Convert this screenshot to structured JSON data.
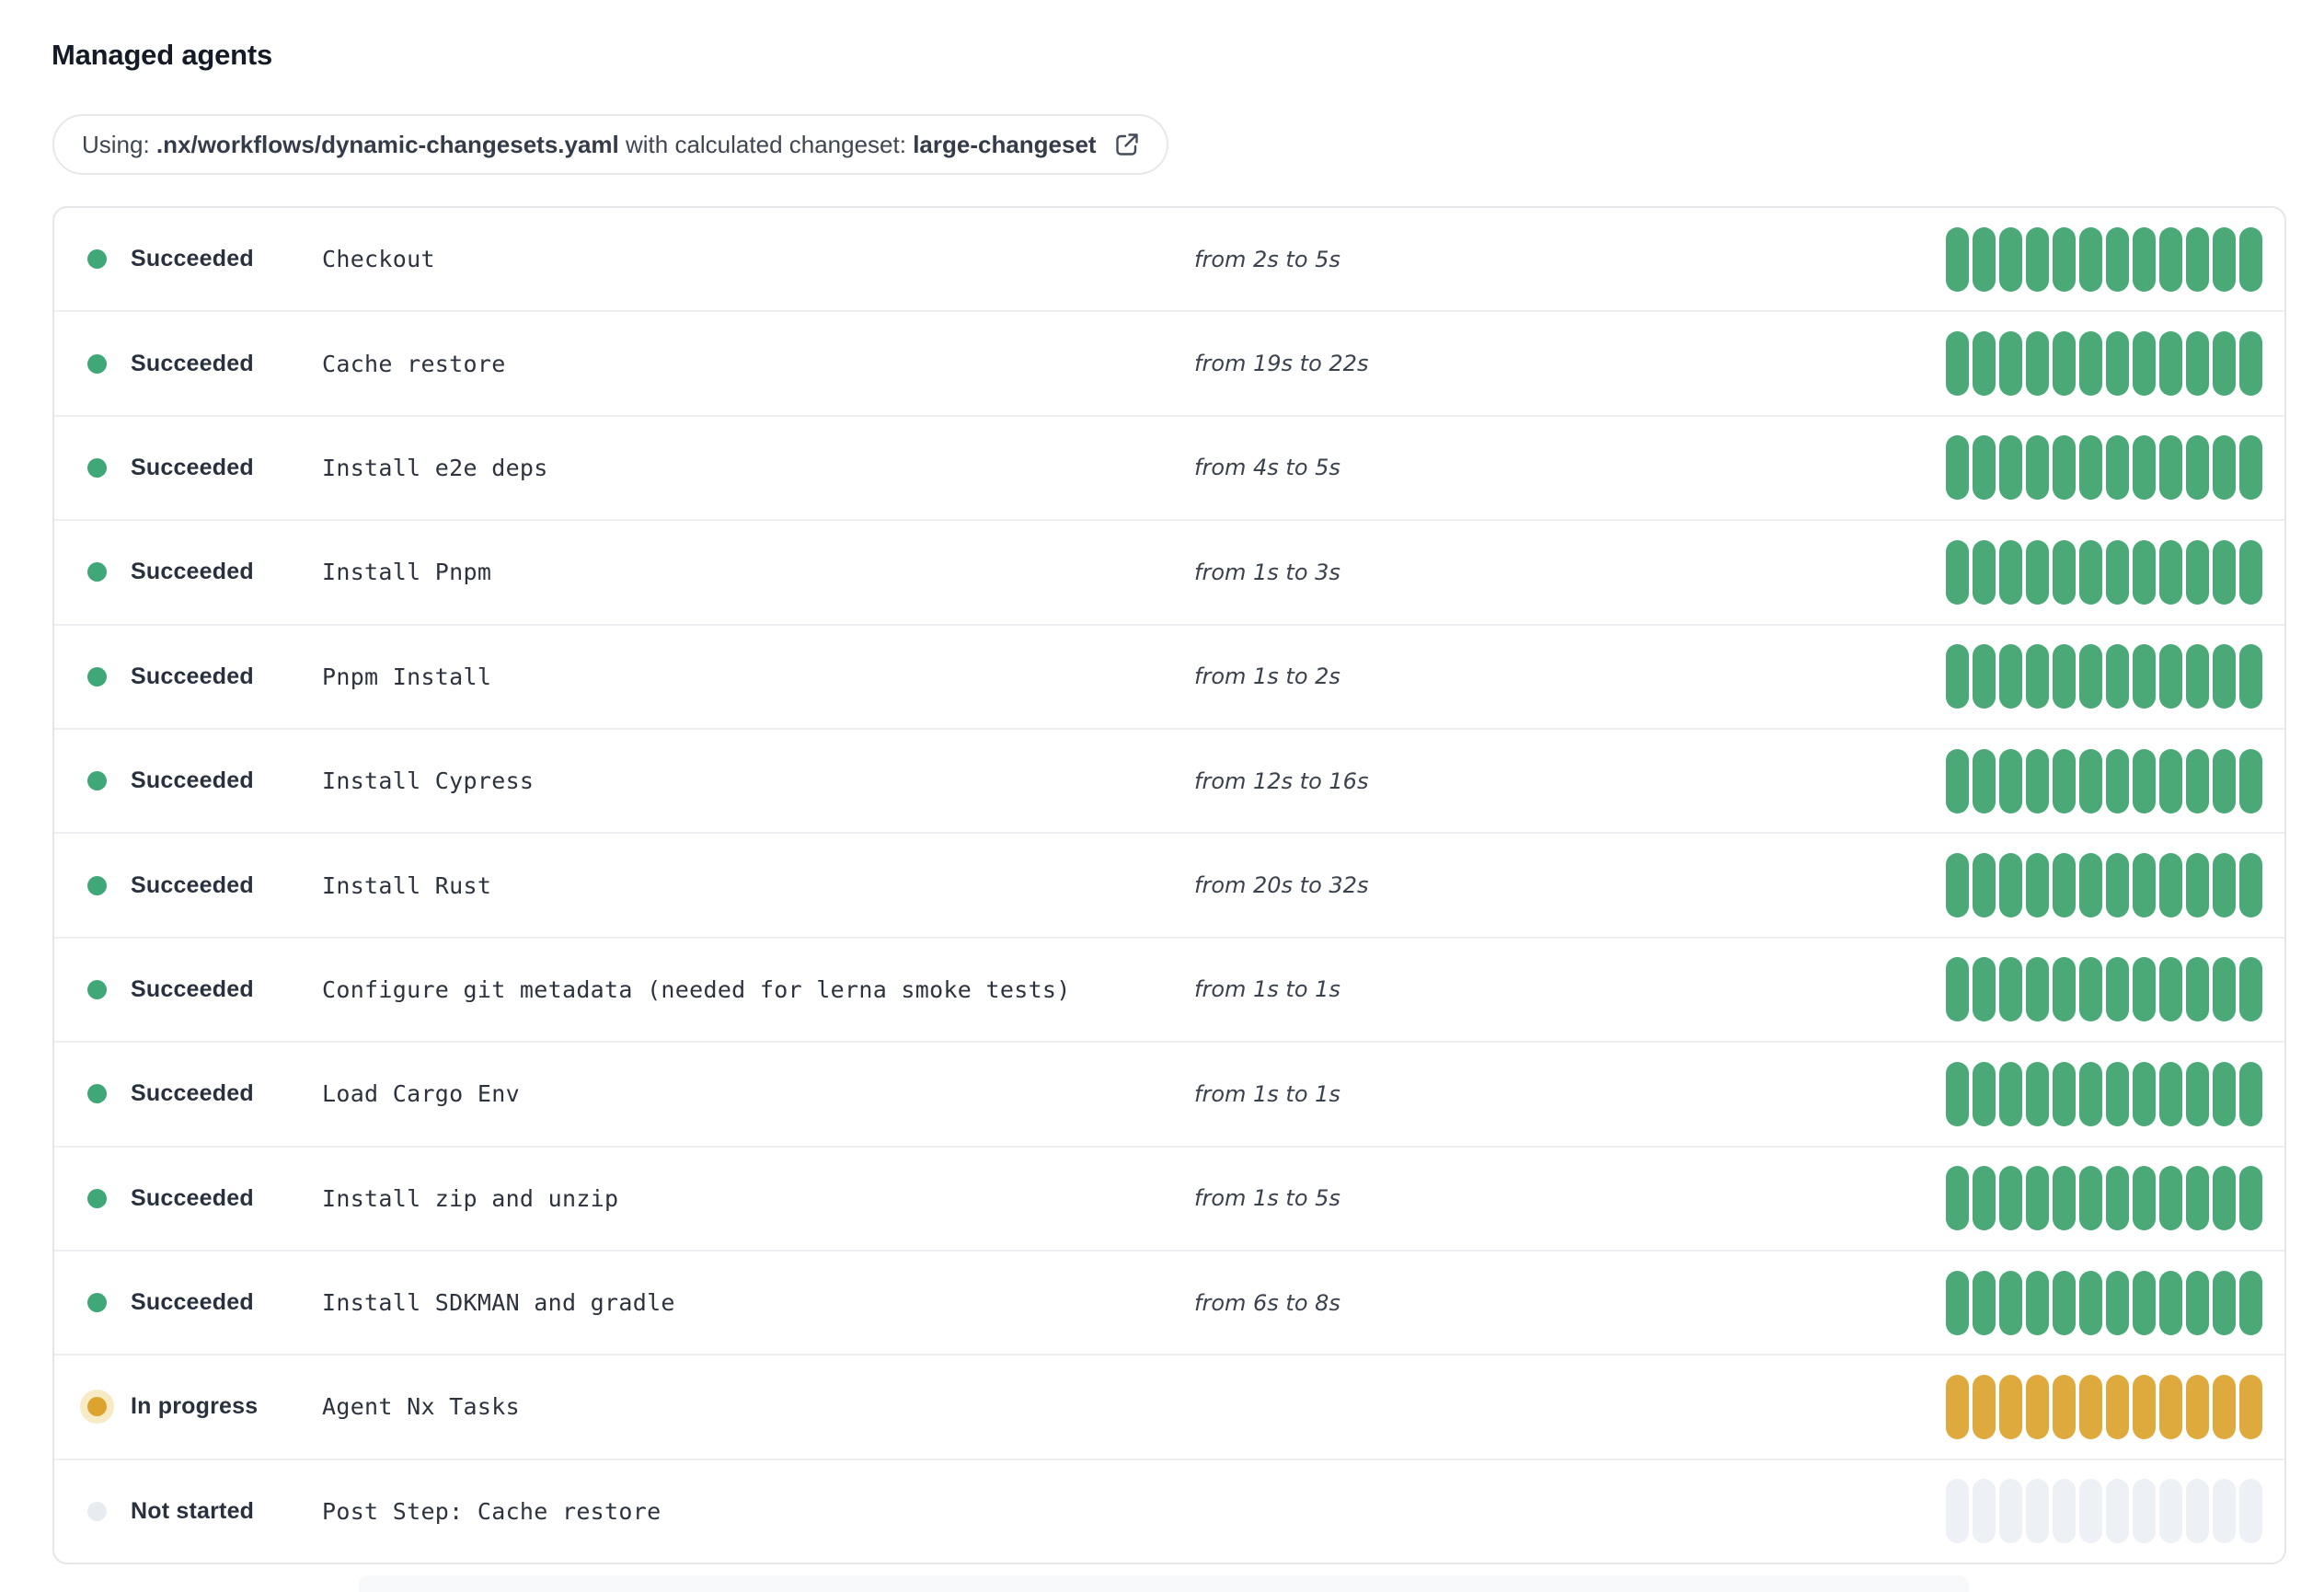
{
  "page": {
    "title": "Managed agents"
  },
  "workflow_banner": {
    "prefix": "Using: ",
    "workflow_path": ".nx/workflows/dynamic-changesets.yaml",
    "middle": " with calculated changeset: ",
    "changeset": "large-changeset",
    "icon": "external-link-icon"
  },
  "colors": {
    "succeeded": "#4BA877",
    "succeeded_dot": "#3FA778",
    "in_progress": "#DEAA3E",
    "in_progress_dot": "#DDA32F",
    "in_progress_halo": "#F7EBC6",
    "not_started": "#EDF0F4",
    "not_started_dot": "#E8ECF1"
  },
  "agents": {
    "segments_per_row": 12,
    "rows": [
      {
        "status": "Succeeded",
        "status_key": "succeeded",
        "step": "Checkout",
        "duration": "from 2s to 5s"
      },
      {
        "status": "Succeeded",
        "status_key": "succeeded",
        "step": "Cache restore",
        "duration": "from 19s to 22s"
      },
      {
        "status": "Succeeded",
        "status_key": "succeeded",
        "step": "Install e2e deps",
        "duration": "from 4s to 5s"
      },
      {
        "status": "Succeeded",
        "status_key": "succeeded",
        "step": "Install Pnpm",
        "duration": "from 1s to 3s"
      },
      {
        "status": "Succeeded",
        "status_key": "succeeded",
        "step": "Pnpm Install",
        "duration": "from 1s to 2s"
      },
      {
        "status": "Succeeded",
        "status_key": "succeeded",
        "step": "Install Cypress",
        "duration": "from 12s to 16s"
      },
      {
        "status": "Succeeded",
        "status_key": "succeeded",
        "step": "Install Rust",
        "duration": "from 20s to 32s"
      },
      {
        "status": "Succeeded",
        "status_key": "succeeded",
        "step": "Configure git metadata (needed for lerna smoke tests)",
        "duration": "from 1s to 1s"
      },
      {
        "status": "Succeeded",
        "status_key": "succeeded",
        "step": "Load Cargo Env",
        "duration": "from 1s to 1s"
      },
      {
        "status": "Succeeded",
        "status_key": "succeeded",
        "step": "Install zip and unzip",
        "duration": "from 1s to 5s"
      },
      {
        "status": "Succeeded",
        "status_key": "succeeded",
        "step": "Install SDKMAN and gradle",
        "duration": "from 6s to 8s"
      },
      {
        "status": "In progress",
        "status_key": "in_progress",
        "step": "Agent Nx Tasks",
        "duration": ""
      },
      {
        "status": "Not started",
        "status_key": "not_started",
        "step": "Post Step: Cache restore",
        "duration": ""
      }
    ]
  }
}
